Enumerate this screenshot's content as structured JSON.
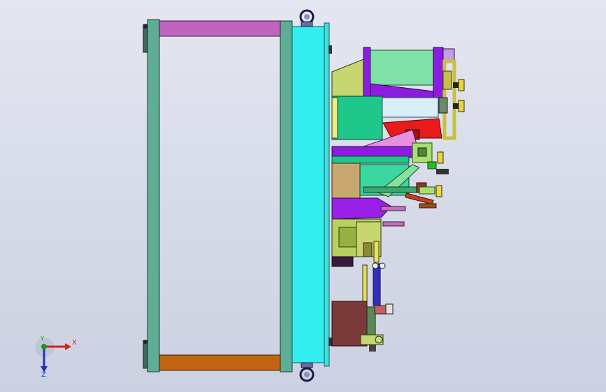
{
  "viewport": {
    "background_top": "#e4e7f1",
    "background_bottom": "#ccd1e2"
  },
  "model": {
    "colors": {
      "frame_green": "#5fad94",
      "top_bar": "#c064c0",
      "bottom_bar": "#c0640f",
      "plate_cyan": "#33eeee",
      "olive": "#c8d670",
      "green_block": "#1fc88a",
      "mint": "#7fe0a8",
      "purple": "#8c1ce0",
      "red": "#e81a1a",
      "pink": "#e890e0",
      "yellow": "#e8e060",
      "tan": "#c8a870",
      "brown": "#7a3a3a"
    }
  },
  "triad": {
    "x_label": "X",
    "y_label": "Y",
    "z_label": "Z",
    "colors": {
      "x": "#d42020",
      "y": "#1a9a1a",
      "z": "#2030c0"
    }
  }
}
